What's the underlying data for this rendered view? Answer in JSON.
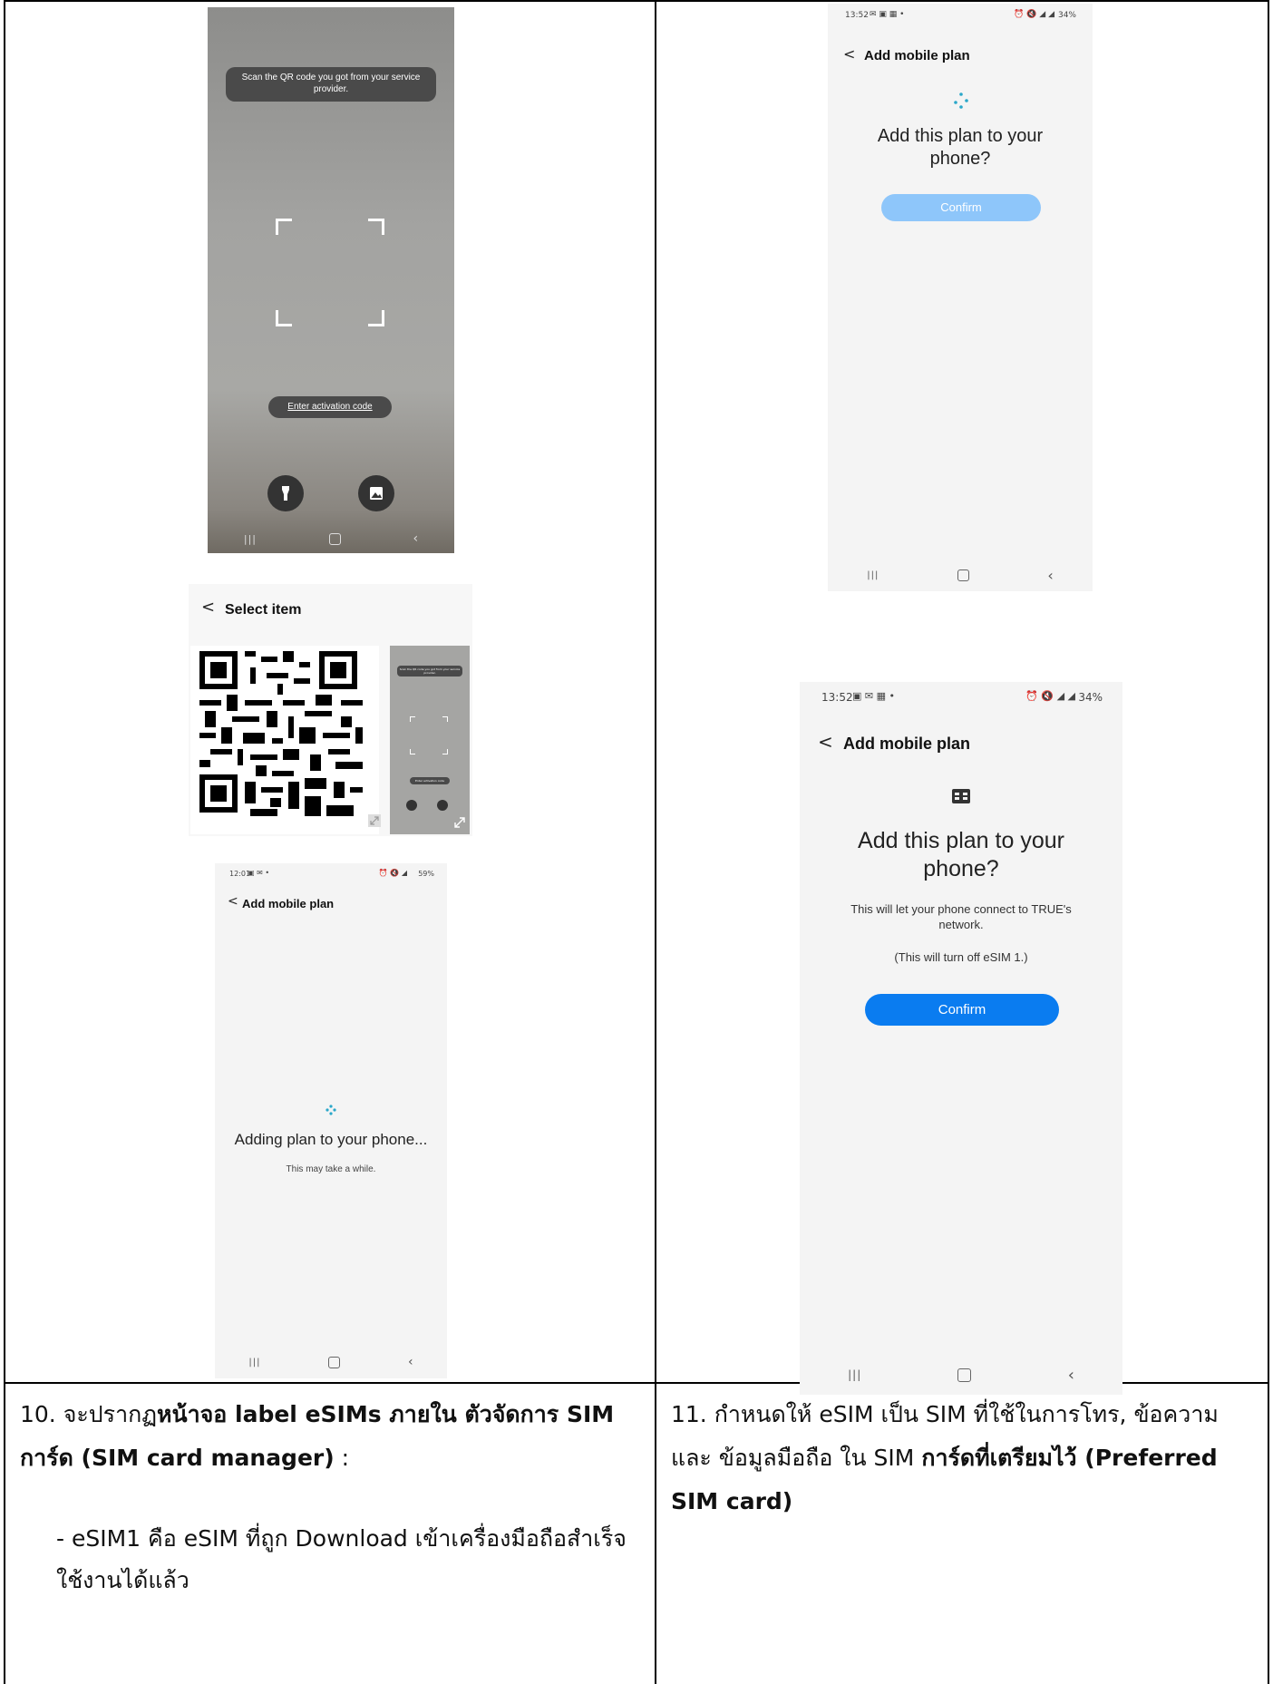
{
  "scan_screen": {
    "hint": "Scan the QR code you got from your service provider.",
    "activation_link": "Enter activation code",
    "flashlight_icon": "flashlight-icon",
    "gallery_icon": "gallery-icon"
  },
  "select_item": {
    "title": "Select item",
    "thumb_hint": "Scan the QR code you got from your service provider.",
    "thumb_link": "Enter activation code"
  },
  "adding_screen": {
    "status_time": "12:01",
    "status_right": "59%",
    "title": "Add mobile plan",
    "heading": "Adding plan to your phone...",
    "sub": "This may take a while."
  },
  "confirm_screen_1": {
    "status_time": "13:52",
    "status_right": "34%",
    "title": "Add mobile plan",
    "heading": "Add this plan to your phone?",
    "button": "Confirm"
  },
  "confirm_screen_2": {
    "status_time": "13:52",
    "status_right": "34%",
    "title": "Add mobile plan",
    "heading": "Add this plan to your phone?",
    "desc": "This will let your phone connect to TRUE's network.",
    "note": "(This will turn off eSIM 1.)",
    "button": "Confirm"
  },
  "step10": {
    "num": "10. จะปรากฏ",
    "bold1": "หน้าจอ label eSIMs ภายใน ตัวจัดการ SIM การ์ด (SIM card manager)",
    "colon": " :",
    "bullet": "- eSIM1  คือ eSIM ที่ถูก Download เข้าเครื่องมือถือสำเร็จใช้งานได้แล้ว"
  },
  "step11": {
    "text1": "11. กำหนดให้ eSIM เป็น SIM ที่ใช้ในการโทร, ข้อความ และ ข้อมูลมือถือ ใน SIM ",
    "bold1": "การ์ดที่เตรียมไว้ (Preferred SIM card)"
  },
  "colors": {
    "accent": "#0a7cf0",
    "accent_light": "#8ec6fa",
    "grid": "#000000"
  }
}
